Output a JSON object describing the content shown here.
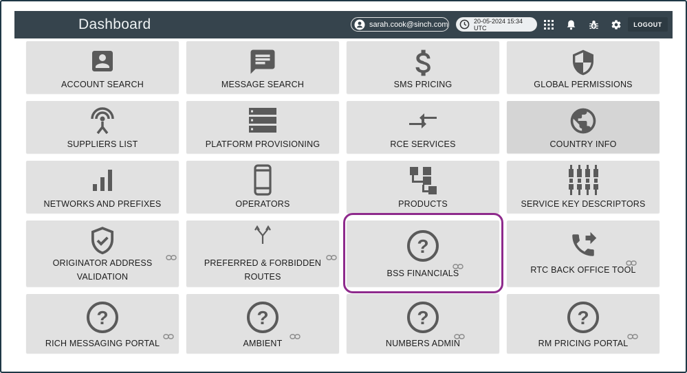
{
  "header": {
    "title": "Dashboard",
    "user_email": "sarah.cook@sinch.com",
    "datetime": "20-05-2024 15:34 UTC",
    "logout_label": "LOGOUT"
  },
  "tiles": [
    {
      "label": "ACCOUNT SEARCH",
      "icon": "account-box-icon"
    },
    {
      "label": "MESSAGE SEARCH",
      "icon": "message-icon"
    },
    {
      "label": "SMS PRICING",
      "icon": "dollar-icon"
    },
    {
      "label": "GLOBAL PERMISSIONS",
      "icon": "shield-icon"
    },
    {
      "label": "SUPPLIERS LIST",
      "icon": "antenna-icon"
    },
    {
      "label": "PLATFORM PROVISIONING",
      "icon": "server-icon"
    },
    {
      "label": "RCE SERVICES",
      "icon": "compare-arrows-icon"
    },
    {
      "label": "COUNTRY INFO",
      "icon": "globe-icon"
    },
    {
      "label": "NETWORKS AND PREFIXES",
      "icon": "signal-bars-icon"
    },
    {
      "label": "OPERATORS",
      "icon": "phone-icon"
    },
    {
      "label": "PRODUCTS",
      "icon": "hierarchy-icon"
    },
    {
      "label": "SERVICE KEY DESCRIPTORS",
      "icon": "cable-icon"
    },
    {
      "label_line1": "ORIGINATOR ADDRESS",
      "label_line2": "VALIDATION",
      "icon": "verified-shield-icon"
    },
    {
      "label_line1": "PREFERRED & FORBIDDEN",
      "label_line2": "ROUTES",
      "icon": "merge-arrows-icon"
    },
    {
      "label": "BSS FINANCIALS",
      "icon": "help-circle-icon"
    },
    {
      "label": "RTC BACK OFFICE TOOL",
      "icon": "phone-forward-icon"
    },
    {
      "label": "RICH MESSAGING PORTAL",
      "icon": "help-circle-icon"
    },
    {
      "label": "AMBIENT",
      "icon": "help-circle-icon"
    },
    {
      "label": "NUMBERS ADMIN",
      "icon": "help-circle-icon"
    },
    {
      "label": "RM PRICING PORTAL",
      "icon": "help-circle-icon"
    }
  ],
  "colors": {
    "topbar": "#36444d",
    "tile": "#e1e1e1",
    "icon": "#5a5a5a",
    "highlight": "#8e2a8c"
  }
}
